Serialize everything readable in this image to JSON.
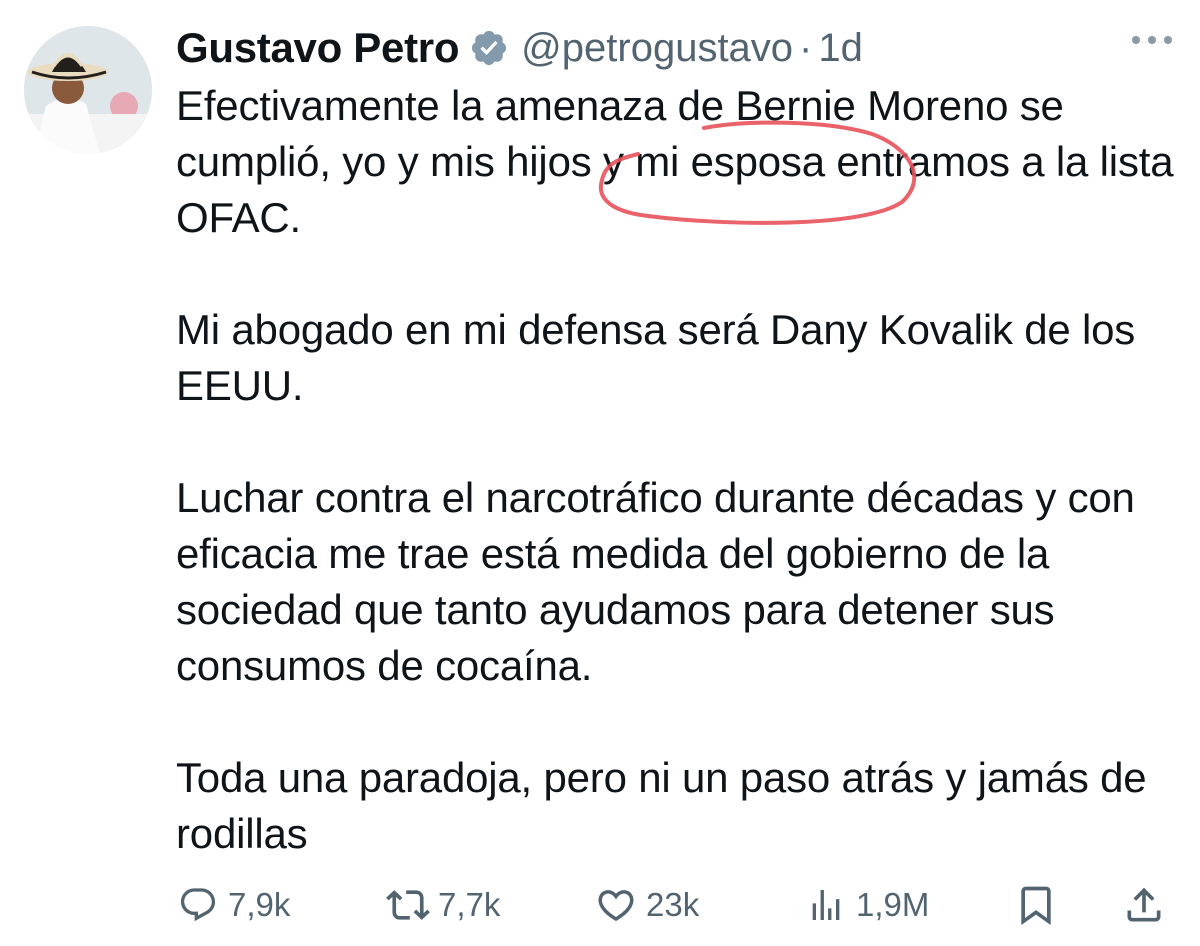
{
  "author": {
    "display_name": "Gustavo Petro",
    "handle": "@petrogustavo",
    "separator": "·",
    "time": "1d",
    "verified_icon": "verified-badge-icon"
  },
  "tweet": {
    "paragraphs": [
      "Efectivamente la amenaza de Bernie Moreno se cumplió, yo y mis hijos y mi esposa entramos a la lista OFAC.",
      "Mi abogado en mi defensa será Dany Kovalik de los EEUU.",
      "Luchar contra el narcotráfico durante  décadas y con eficacia me trae está medida del gobierno de la sociedad que tanto ayudamos para detener sus consumos de cocaína.",
      "Toda una paradoja, pero ni un paso atrás y jamás de rodillas"
    ],
    "highlight_color": "#e8515a"
  },
  "actions": {
    "replies": "7,9k",
    "retweets": "7,7k",
    "likes": "23k",
    "views": "1,9M"
  },
  "colors": {
    "text": "#0f1419",
    "secondary": "#536471",
    "verified": "#829aab"
  }
}
